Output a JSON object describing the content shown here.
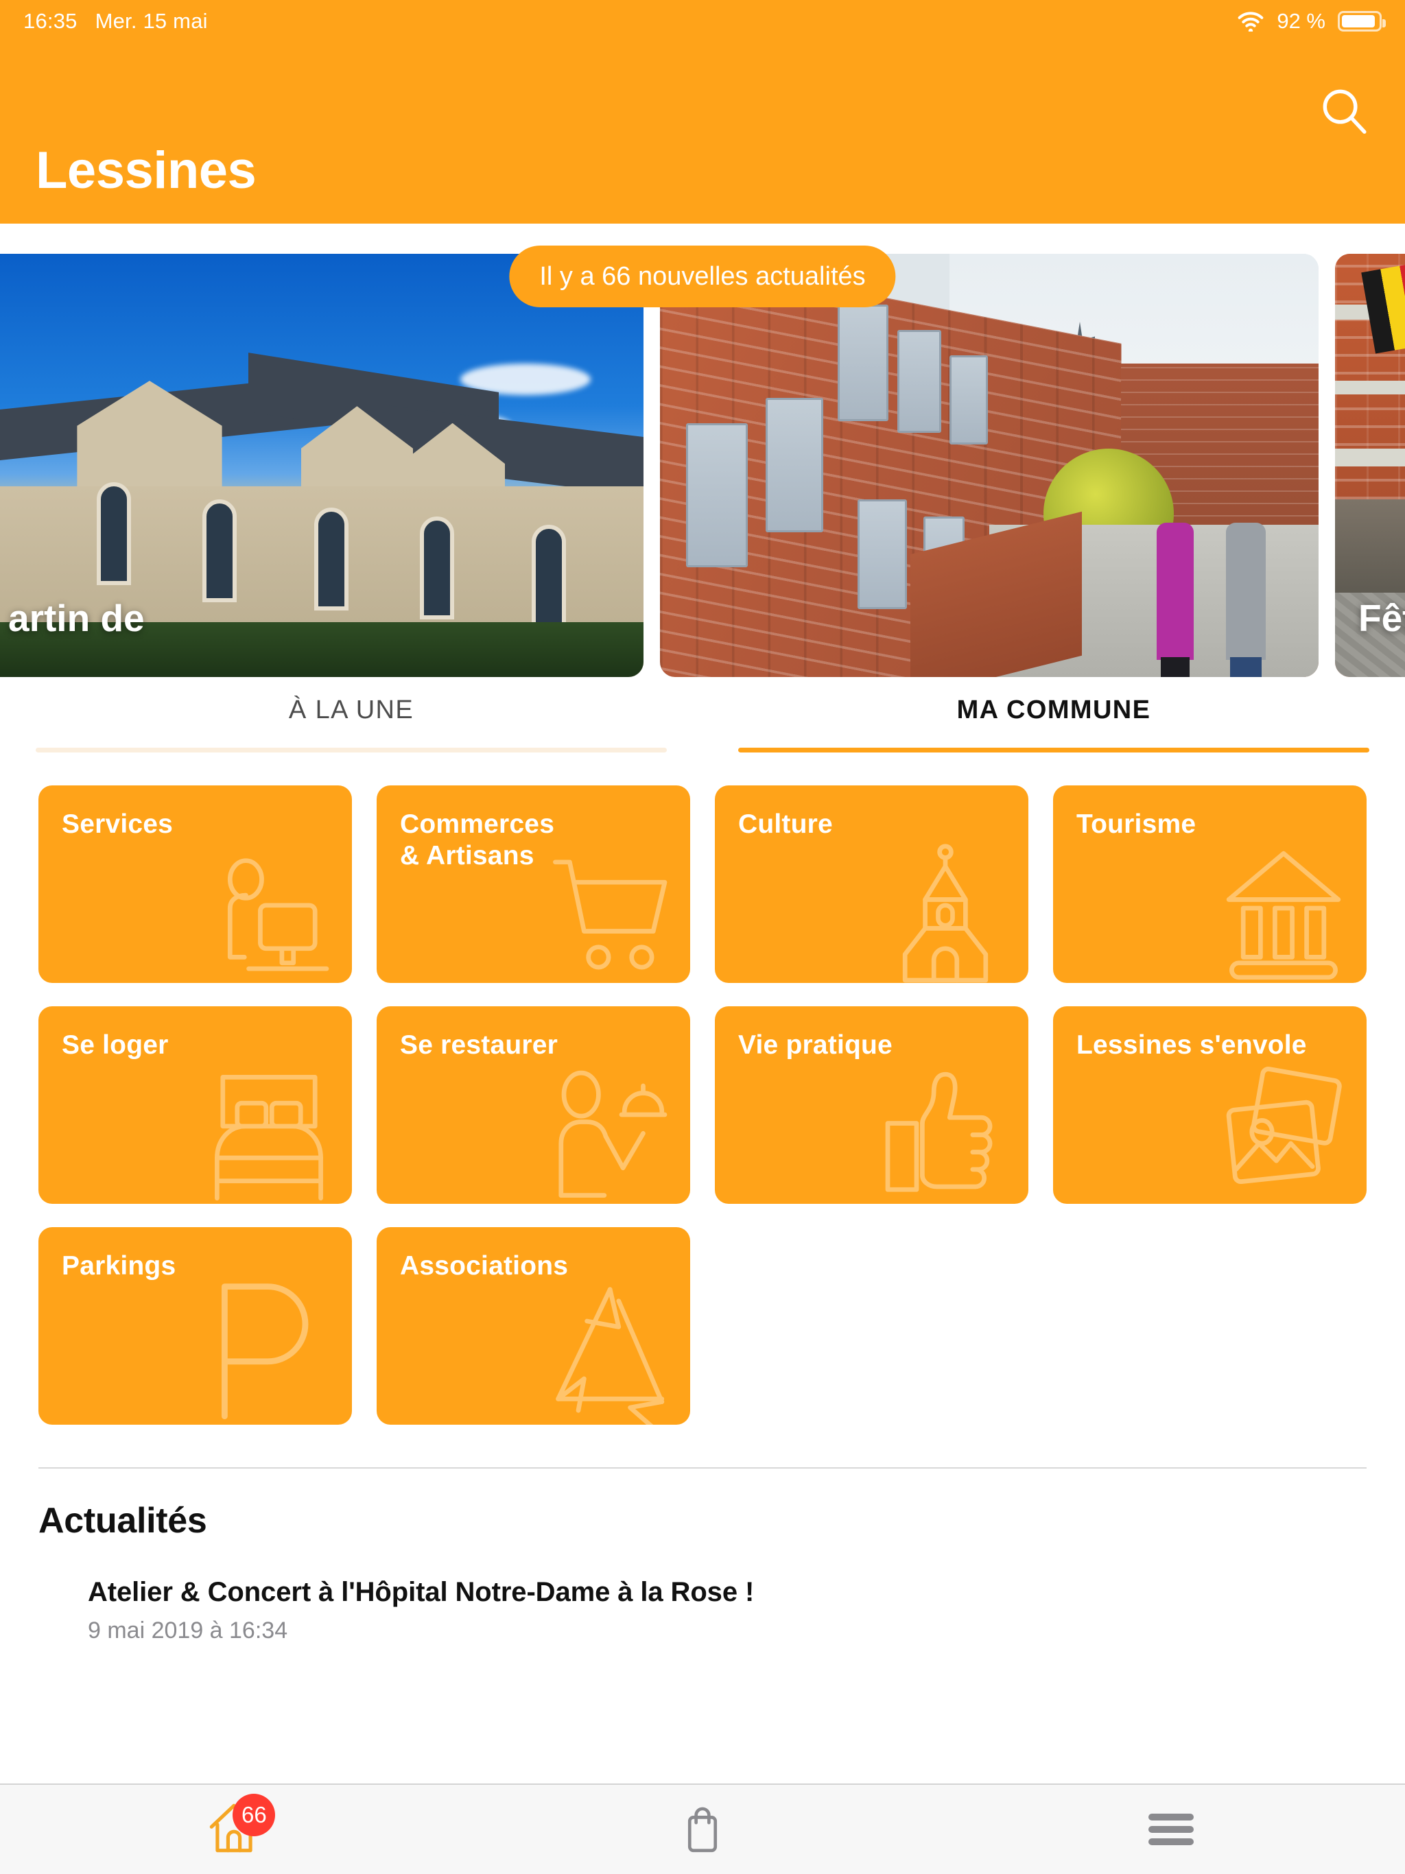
{
  "status_bar": {
    "time": "16:35",
    "date": "Mer. 15 mai",
    "battery_percent": "92 %",
    "wifi_icon": "wifi-icon",
    "battery_icon": "battery-icon"
  },
  "nav": {
    "title": "Lessines",
    "search_icon": "search-icon"
  },
  "carousel": {
    "notification_pill": "Il y a 66 nouvelles actualités",
    "slides": [
      {
        "caption": "artin de",
        "alt": "eglise-saint-martin"
      },
      {
        "caption": "",
        "alt": "rue-hopital-notre-dame"
      },
      {
        "caption": "Fêtes Historiques",
        "alt": "fetes-historiques"
      }
    ]
  },
  "tabs": [
    {
      "label": "À LA UNE",
      "active": false
    },
    {
      "label": "MA COMMUNE",
      "active": true
    }
  ],
  "tiles": [
    {
      "label": "Services",
      "icon": "desk-person-icon"
    },
    {
      "label": "Commerces\n& Artisans",
      "icon": "shopping-cart-icon"
    },
    {
      "label": "Culture",
      "icon": "church-icon"
    },
    {
      "label": "Tourisme",
      "icon": "museum-icon"
    },
    {
      "label": "Se loger",
      "icon": "bed-icon"
    },
    {
      "label": "Se restaurer",
      "icon": "waiter-icon"
    },
    {
      "label": "Vie pratique",
      "icon": "thumbs-up-icon"
    },
    {
      "label": "Lessines s'envole",
      "icon": "photos-icon"
    },
    {
      "label": "Parkings",
      "icon": "parking-p-icon"
    },
    {
      "label": "Associations",
      "icon": "recycle-arrows-icon"
    }
  ],
  "news": {
    "heading": "Actualités",
    "items": [
      {
        "title": "Atelier & Concert à l'Hôpital Notre-Dame à la Rose !",
        "date": "9 mai 2019 à 16:34"
      }
    ]
  },
  "tab_bar": {
    "items": [
      {
        "icon": "home-icon",
        "badge": "66",
        "active": true
      },
      {
        "icon": "shopping-bag-icon",
        "badge": "",
        "active": false
      },
      {
        "icon": "hamburger-menu-icon",
        "badge": "",
        "active": false
      }
    ]
  },
  "colors": {
    "brand_orange": "#FFA319",
    "badge_red": "#FF3B30",
    "inactive_gray": "#8A8A8E"
  }
}
